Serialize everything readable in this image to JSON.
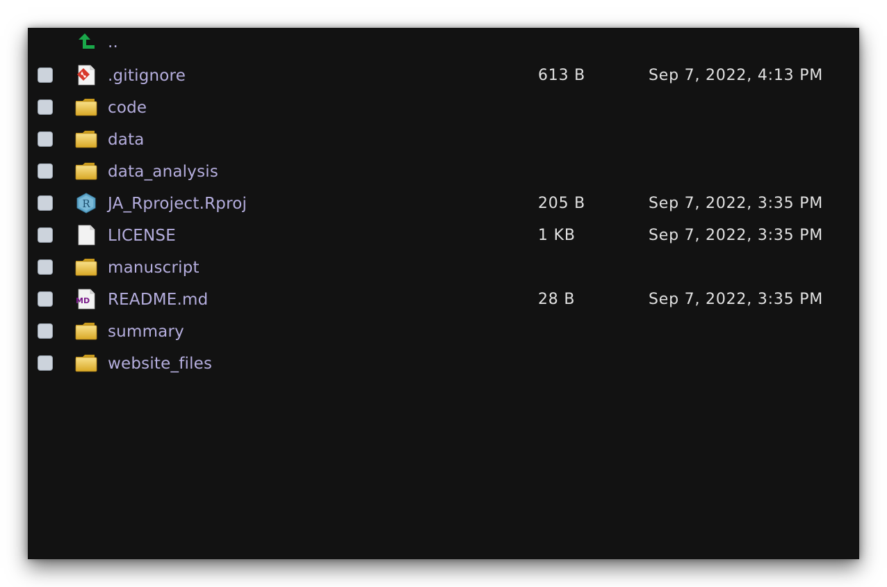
{
  "parent_link": {
    "label": "..",
    "icon": "up-arrow-icon"
  },
  "files": [
    {
      "name": ".gitignore",
      "icon": "git-file-icon",
      "size": "613 B",
      "modified": "Sep 7, 2022, 4:13 PM"
    },
    {
      "name": "code",
      "icon": "folder-icon",
      "size": "",
      "modified": ""
    },
    {
      "name": "data",
      "icon": "folder-icon",
      "size": "",
      "modified": ""
    },
    {
      "name": "data_analysis",
      "icon": "folder-icon",
      "size": "",
      "modified": ""
    },
    {
      "name": "JA_Rproject.Rproj",
      "icon": "rproj-file-icon",
      "size": "205 B",
      "modified": "Sep 7, 2022, 3:35 PM"
    },
    {
      "name": "LICENSE",
      "icon": "text-file-icon",
      "size": "1 KB",
      "modified": "Sep 7, 2022, 3:35 PM"
    },
    {
      "name": "manuscript",
      "icon": "folder-icon",
      "size": "",
      "modified": ""
    },
    {
      "name": "README.md",
      "icon": "markdown-file-icon",
      "size": "28 B",
      "modified": "Sep 7, 2022, 3:35 PM"
    },
    {
      "name": "summary",
      "icon": "folder-icon",
      "size": "",
      "modified": ""
    },
    {
      "name": "website_files",
      "icon": "folder-icon",
      "size": "",
      "modified": ""
    }
  ],
  "colors": {
    "background": "#121212",
    "link_text": "#b5aede",
    "meta_text": "#e2e2e2",
    "folder": "#e8c14a",
    "up_arrow": "#1aa84a"
  }
}
